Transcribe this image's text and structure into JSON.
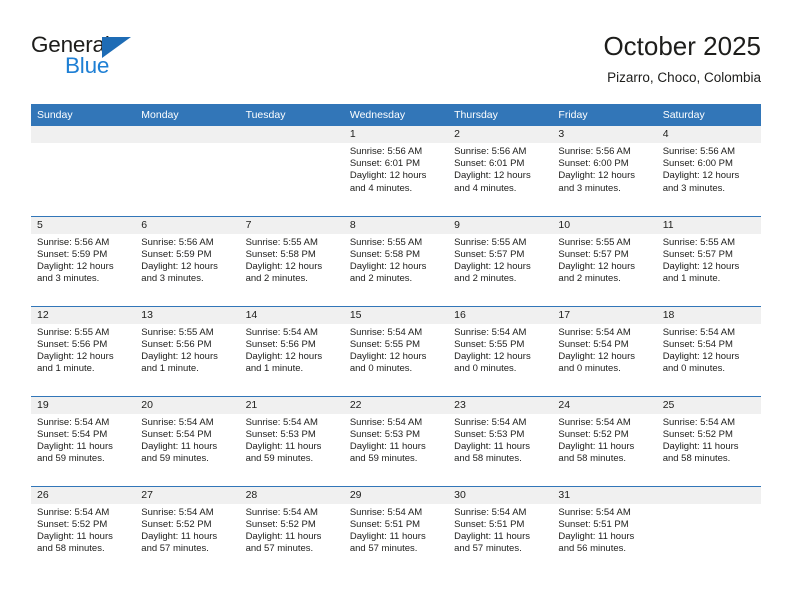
{
  "brand": {
    "word1": "General",
    "word2": "Blue",
    "flag_icon": "triangle-flag-icon",
    "colors": {
      "general": "#1d1d1b",
      "blue": "#1e7fd4",
      "flag": "#1e6cb5"
    }
  },
  "header": {
    "title": "October 2025",
    "subtitle": "Pizarro, Choco, Colombia"
  },
  "theme": {
    "header_row_bg": "#3276b8",
    "daynum_bg": "#f0f0f0",
    "grid_line": "#3276b8",
    "text": "#1d1d1b"
  },
  "calendar": {
    "weekday_headers": [
      "Sunday",
      "Monday",
      "Tuesday",
      "Wednesday",
      "Thursday",
      "Friday",
      "Saturday"
    ],
    "weeks": [
      [
        {
          "day": "",
          "empty": true,
          "lines": []
        },
        {
          "day": "",
          "empty": true,
          "lines": []
        },
        {
          "day": "",
          "empty": true,
          "lines": []
        },
        {
          "day": "1",
          "empty": false,
          "lines": [
            "Sunrise: 5:56 AM",
            "Sunset: 6:01 PM",
            "Daylight: 12 hours",
            "and 4 minutes."
          ]
        },
        {
          "day": "2",
          "empty": false,
          "lines": [
            "Sunrise: 5:56 AM",
            "Sunset: 6:01 PM",
            "Daylight: 12 hours",
            "and 4 minutes."
          ]
        },
        {
          "day": "3",
          "empty": false,
          "lines": [
            "Sunrise: 5:56 AM",
            "Sunset: 6:00 PM",
            "Daylight: 12 hours",
            "and 3 minutes."
          ]
        },
        {
          "day": "4",
          "empty": false,
          "lines": [
            "Sunrise: 5:56 AM",
            "Sunset: 6:00 PM",
            "Daylight: 12 hours",
            "and 3 minutes."
          ]
        }
      ],
      [
        {
          "day": "5",
          "empty": false,
          "lines": [
            "Sunrise: 5:56 AM",
            "Sunset: 5:59 PM",
            "Daylight: 12 hours",
            "and 3 minutes."
          ]
        },
        {
          "day": "6",
          "empty": false,
          "lines": [
            "Sunrise: 5:56 AM",
            "Sunset: 5:59 PM",
            "Daylight: 12 hours",
            "and 3 minutes."
          ]
        },
        {
          "day": "7",
          "empty": false,
          "lines": [
            "Sunrise: 5:55 AM",
            "Sunset: 5:58 PM",
            "Daylight: 12 hours",
            "and 2 minutes."
          ]
        },
        {
          "day": "8",
          "empty": false,
          "lines": [
            "Sunrise: 5:55 AM",
            "Sunset: 5:58 PM",
            "Daylight: 12 hours",
            "and 2 minutes."
          ]
        },
        {
          "day": "9",
          "empty": false,
          "lines": [
            "Sunrise: 5:55 AM",
            "Sunset: 5:57 PM",
            "Daylight: 12 hours",
            "and 2 minutes."
          ]
        },
        {
          "day": "10",
          "empty": false,
          "lines": [
            "Sunrise: 5:55 AM",
            "Sunset: 5:57 PM",
            "Daylight: 12 hours",
            "and 2 minutes."
          ]
        },
        {
          "day": "11",
          "empty": false,
          "lines": [
            "Sunrise: 5:55 AM",
            "Sunset: 5:57 PM",
            "Daylight: 12 hours",
            "and 1 minute."
          ]
        }
      ],
      [
        {
          "day": "12",
          "empty": false,
          "lines": [
            "Sunrise: 5:55 AM",
            "Sunset: 5:56 PM",
            "Daylight: 12 hours",
            "and 1 minute."
          ]
        },
        {
          "day": "13",
          "empty": false,
          "lines": [
            "Sunrise: 5:55 AM",
            "Sunset: 5:56 PM",
            "Daylight: 12 hours",
            "and 1 minute."
          ]
        },
        {
          "day": "14",
          "empty": false,
          "lines": [
            "Sunrise: 5:54 AM",
            "Sunset: 5:56 PM",
            "Daylight: 12 hours",
            "and 1 minute."
          ]
        },
        {
          "day": "15",
          "empty": false,
          "lines": [
            "Sunrise: 5:54 AM",
            "Sunset: 5:55 PM",
            "Daylight: 12 hours",
            "and 0 minutes."
          ]
        },
        {
          "day": "16",
          "empty": false,
          "lines": [
            "Sunrise: 5:54 AM",
            "Sunset: 5:55 PM",
            "Daylight: 12 hours",
            "and 0 minutes."
          ]
        },
        {
          "day": "17",
          "empty": false,
          "lines": [
            "Sunrise: 5:54 AM",
            "Sunset: 5:54 PM",
            "Daylight: 12 hours",
            "and 0 minutes."
          ]
        },
        {
          "day": "18",
          "empty": false,
          "lines": [
            "Sunrise: 5:54 AM",
            "Sunset: 5:54 PM",
            "Daylight: 12 hours",
            "and 0 minutes."
          ]
        }
      ],
      [
        {
          "day": "19",
          "empty": false,
          "lines": [
            "Sunrise: 5:54 AM",
            "Sunset: 5:54 PM",
            "Daylight: 11 hours",
            "and 59 minutes."
          ]
        },
        {
          "day": "20",
          "empty": false,
          "lines": [
            "Sunrise: 5:54 AM",
            "Sunset: 5:54 PM",
            "Daylight: 11 hours",
            "and 59 minutes."
          ]
        },
        {
          "day": "21",
          "empty": false,
          "lines": [
            "Sunrise: 5:54 AM",
            "Sunset: 5:53 PM",
            "Daylight: 11 hours",
            "and 59 minutes."
          ]
        },
        {
          "day": "22",
          "empty": false,
          "lines": [
            "Sunrise: 5:54 AM",
            "Sunset: 5:53 PM",
            "Daylight: 11 hours",
            "and 59 minutes."
          ]
        },
        {
          "day": "23",
          "empty": false,
          "lines": [
            "Sunrise: 5:54 AM",
            "Sunset: 5:53 PM",
            "Daylight: 11 hours",
            "and 58 minutes."
          ]
        },
        {
          "day": "24",
          "empty": false,
          "lines": [
            "Sunrise: 5:54 AM",
            "Sunset: 5:52 PM",
            "Daylight: 11 hours",
            "and 58 minutes."
          ]
        },
        {
          "day": "25",
          "empty": false,
          "lines": [
            "Sunrise: 5:54 AM",
            "Sunset: 5:52 PM",
            "Daylight: 11 hours",
            "and 58 minutes."
          ]
        }
      ],
      [
        {
          "day": "26",
          "empty": false,
          "lines": [
            "Sunrise: 5:54 AM",
            "Sunset: 5:52 PM",
            "Daylight: 11 hours",
            "and 58 minutes."
          ]
        },
        {
          "day": "27",
          "empty": false,
          "lines": [
            "Sunrise: 5:54 AM",
            "Sunset: 5:52 PM",
            "Daylight: 11 hours",
            "and 57 minutes."
          ]
        },
        {
          "day": "28",
          "empty": false,
          "lines": [
            "Sunrise: 5:54 AM",
            "Sunset: 5:52 PM",
            "Daylight: 11 hours",
            "and 57 minutes."
          ]
        },
        {
          "day": "29",
          "empty": false,
          "lines": [
            "Sunrise: 5:54 AM",
            "Sunset: 5:51 PM",
            "Daylight: 11 hours",
            "and 57 minutes."
          ]
        },
        {
          "day": "30",
          "empty": false,
          "lines": [
            "Sunrise: 5:54 AM",
            "Sunset: 5:51 PM",
            "Daylight: 11 hours",
            "and 57 minutes."
          ]
        },
        {
          "day": "31",
          "empty": false,
          "lines": [
            "Sunrise: 5:54 AM",
            "Sunset: 5:51 PM",
            "Daylight: 11 hours",
            "and 56 minutes."
          ]
        },
        {
          "day": "",
          "empty": true,
          "lines": []
        }
      ]
    ]
  }
}
